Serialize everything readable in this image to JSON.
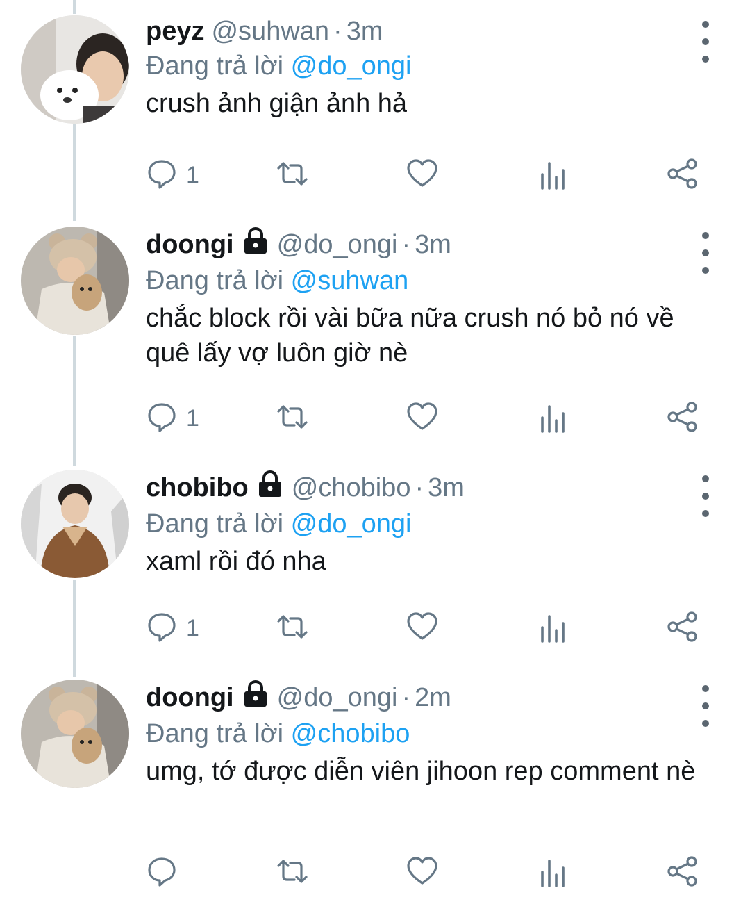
{
  "reply_prefix": "Đang trả lời",
  "colors": {
    "link": "#1da1f2",
    "secondary": "#657786",
    "text": "#14171a",
    "thread_line": "#cfd9de"
  },
  "tweets": [
    {
      "name": "peyz",
      "handle": "@suhwan",
      "separator": "·",
      "time": "3m",
      "locked": false,
      "replying_to": "@do_ongi",
      "text": "crush ảnh giận ảnh hả",
      "reply_count": "1",
      "avatar": "white-dog-avatar"
    },
    {
      "name": "doongi",
      "handle": "@do_ongi",
      "separator": "·",
      "time": "3m",
      "locked": true,
      "replying_to": "@suhwan",
      "text": "chắc block rồi vài bữa nữa crush nó bỏ nó về quê lấy vợ luôn giờ nè",
      "reply_count": "1",
      "avatar": "bear-hat-avatar"
    },
    {
      "name": "chobibo",
      "handle": "@chobibo",
      "separator": "·",
      "time": "3m",
      "locked": true,
      "replying_to": "@do_ongi",
      "text": "xaml rồi đó nha",
      "reply_count": "1",
      "avatar": "snow-jacket-avatar"
    },
    {
      "name": "doongi",
      "handle": "@do_ongi",
      "separator": "·",
      "time": "2m",
      "locked": true,
      "replying_to": "@chobibo",
      "text": "umg, tớ được diễn viên jihoon rep comment nè",
      "reply_count": "",
      "avatar": "bear-hat-avatar"
    }
  ]
}
